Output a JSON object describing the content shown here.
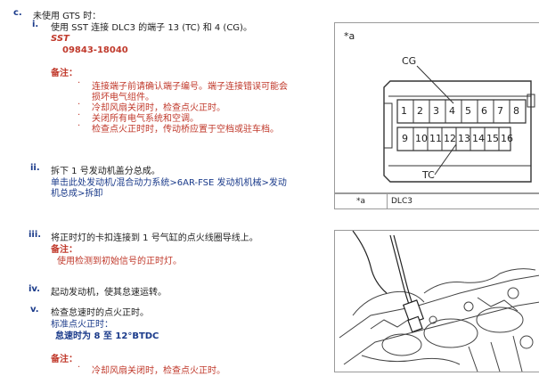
{
  "step_c": {
    "label": "c.",
    "title": "未使用 GTS 时：",
    "i": {
      "label": "i.",
      "text": "使用 SST 连接 DLC3 的端子 13 (TC) 和 4 (CG)。",
      "sst_label": "SST",
      "sst_part": "09843-18040",
      "note_label": "备注：",
      "notes": [
        "连接端子前请确认端子编号。端子连接错误可能会",
        "损坏电气组件。",
        "冷却风扇关闭时，检查点火正时。",
        "关闭所有电气系统和空调。",
        "检查点火正时时，传动桥应置于空档或驻车档。"
      ]
    },
    "ii": {
      "label": "ii.",
      "text": "拆下 1 号发动机盖分总成。",
      "link_line1": "单击此处发动机/混合动力系统>6AR-FSE 发动机机械>发动",
      "link_line2": "机总成>拆卸"
    },
    "iii": {
      "label": "iii.",
      "text": "将正时灯的卡扣连接到 1 号气缸的点火线圈导线上。",
      "note_label": "备注：",
      "note": "使用检测到初始信号的正时灯。"
    },
    "iv": {
      "label": "iv.",
      "text": "起动发动机，使其怠速运转。"
    },
    "v": {
      "label": "v.",
      "text": "检查怠速时的点火正时。",
      "std_label": "标准点火正时：",
      "std_value": "怠速时为 8 至 12°BTDC",
      "note_label": "备注：",
      "note": "冷却风扇关闭时，检查点火正时。"
    }
  },
  "figure1": {
    "tag": "*a",
    "cg": "CG",
    "tc": "TC",
    "top_pins": [
      "1",
      "2",
      "3",
      "4",
      "5",
      "6",
      "7",
      "8"
    ],
    "bottom_pins": [
      "9",
      "10",
      "11",
      "12",
      "13",
      "14",
      "15",
      "16"
    ],
    "legend_key": "*a",
    "legend_value": "DLC3"
  },
  "figure2": {
    "alt": "timing light engine illustration"
  }
}
